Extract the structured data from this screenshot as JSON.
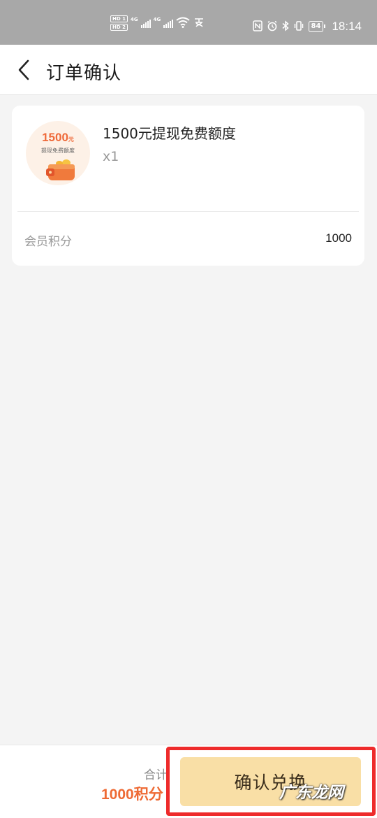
{
  "status_bar": {
    "hd1": "HD 1",
    "hd2": "HD 2",
    "net1": "4G",
    "net2": "4G",
    "battery": "84",
    "time": "18:14"
  },
  "header": {
    "title": "订单确认",
    "back_icon": "chevron-left-icon"
  },
  "order": {
    "thumbnail": {
      "amount": "1500",
      "amount_unit": "元",
      "caption": "提现免费额度"
    },
    "product_name": "1500元提现免费额度",
    "quantity": "x1",
    "points_label": "会员积分",
    "points_value": "1000"
  },
  "footer": {
    "total_label": "合计",
    "total_value": "1000积分",
    "confirm_label": "确认兑换",
    "watermark": "广东龙网"
  },
  "colors": {
    "accent": "#ee6a34",
    "button_bg": "#f9dfa6",
    "highlight": "#ee2b2b"
  }
}
